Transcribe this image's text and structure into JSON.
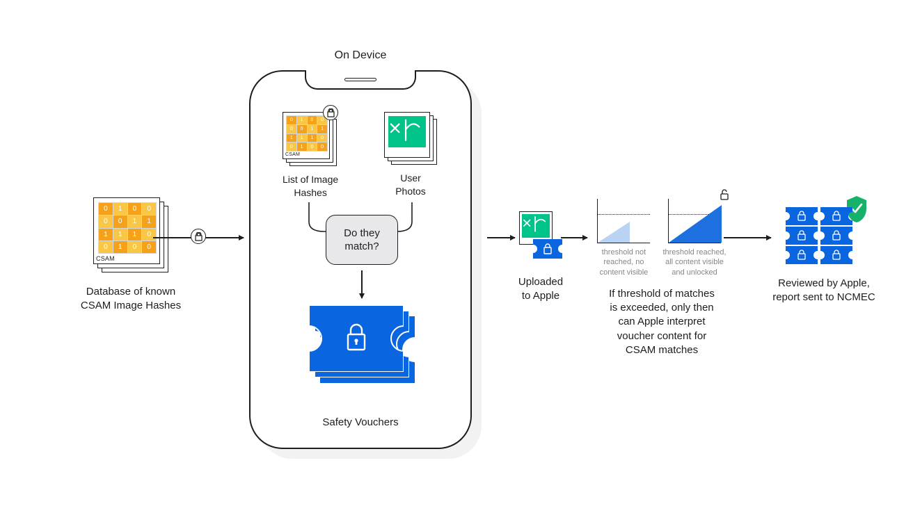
{
  "stage1": {
    "csam_tag": "CSAM",
    "label": "Database of known\nCSAM Image Hashes"
  },
  "phone": {
    "title": "On Device",
    "list_hashes": {
      "csam_tag": "CSAM",
      "label": "List of Image\nHashes"
    },
    "user_photos": {
      "label": "User\nPhotos"
    },
    "match_box": "Do they\nmatch?",
    "safety_vouchers": "Safety Vouchers"
  },
  "stage3": {
    "label": "Uploaded\nto Apple"
  },
  "stage4": {
    "threshold_not": "threshold not\nreached, no\ncontent visible",
    "threshold_reached": "threshold reached,\nall content visible\nand unlocked",
    "label": "If threshold of matches\nis exceeded, only then\ncan Apple interpret\nvoucher content for\nCSAM matches"
  },
  "stage5": {
    "label": "Reviewed by Apple,\nreport sent to NCMEC"
  },
  "colors": {
    "csam_cells": [
      "#f6a11a",
      "#f9c745",
      "#f6a11a",
      "#f9c745",
      "#f9c745",
      "#f6a11a",
      "#f9c745",
      "#f6a11a",
      "#f6a11a",
      "#f9c745",
      "#f6a11a",
      "#f9c745",
      "#f9c745",
      "#f6a11a",
      "#f9c745",
      "#f6a11a"
    ],
    "csam_digits": [
      "0",
      "1",
      "0",
      "0",
      "0",
      "0",
      "1",
      "1",
      "1",
      "1",
      "1",
      "0",
      "0",
      "1",
      "0",
      "0"
    ],
    "photo_green": "#00c389",
    "voucher_blue": "#0a66e0",
    "chart_light": "#b9d3f2",
    "chart_dark": "#1e6fe0",
    "shield_green": "#17b26a"
  }
}
